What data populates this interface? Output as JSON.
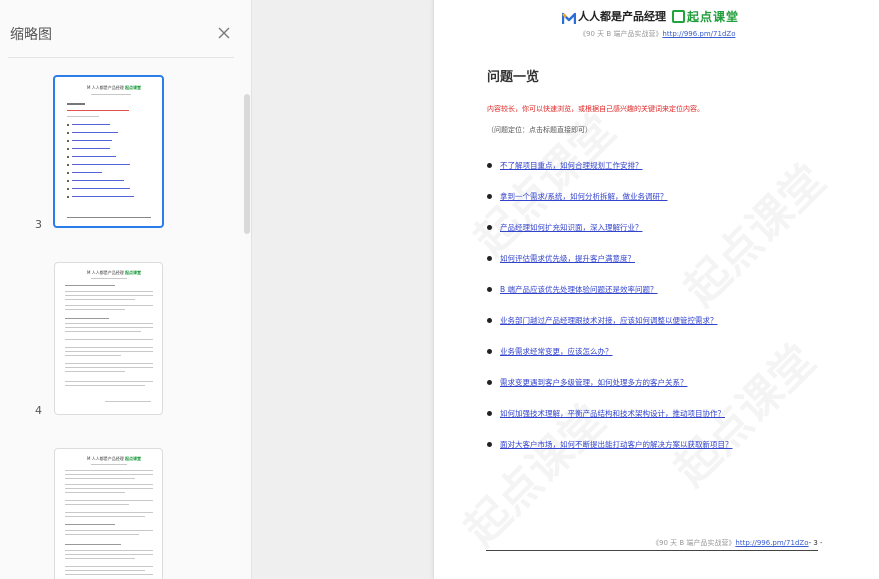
{
  "sidebar": {
    "title": "缩略图",
    "close_icon": "close-icon",
    "thumbnails": [
      {
        "page_number": "3",
        "active": true
      },
      {
        "page_number": "4",
        "active": false
      },
      {
        "page_number": "",
        "active": false
      }
    ]
  },
  "document": {
    "logo": {
      "brand1": "人人都是产品经理",
      "brand2": "起点课堂",
      "brand2_color": "#1f9e3a"
    },
    "subtitle_prefix": "《90 天 B 端产品实战营》",
    "subtitle_link": "http://996.pm/71dZo",
    "heading": "问题一览",
    "notice": "内容较长，你可以快速浏览，或根据自己感兴趣的关键词来定位内容。",
    "hint": "（问题定位：点击标题直接即可）",
    "questions": [
      "不了解项目重点，如何合理规划工作安排？",
      "拿到一个需求/系统，如何分析拆解，做业务调研？",
      "产品经理如何扩充知识面，深入理解行业？",
      "如何评估需求优先级，提升客户满意度？",
      "B 端产品应该优先处理体验问题还是效率问题？",
      "业务部门越过产品经理跟技术对接，应该如何调整以便管控需求？",
      "业务需求经常变更，应该怎么办？",
      "需求变更遇到客户多级管理，如何处理多方的客户关系？",
      "如何加强技术理解，平衡产品结构和技术架构设计，推动项目协作？",
      "面对大客户市场，如何不断提出能打动客户的解决方案以获取新项目？"
    ],
    "footer_prefix": "《90 天 B 端产品实战营》",
    "footer_link": "http://996.pm/71dZo",
    "page_number": "- 3 -",
    "watermark": "起点课堂",
    "notice_color": "#e02525",
    "link_color": "#3344cc"
  }
}
